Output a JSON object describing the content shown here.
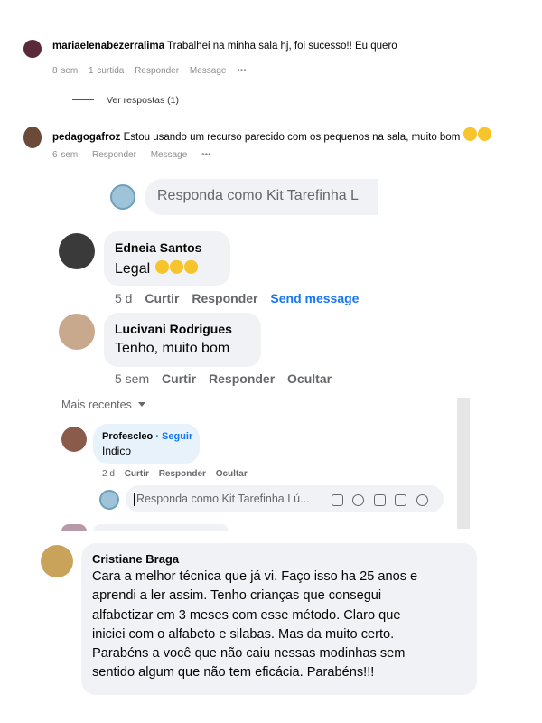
{
  "ig_comments": [
    {
      "username": "mariaelenabezerralima",
      "text": "Trabalhei na minha sala hj, foi sucesso!! Eu quero",
      "time": "8 sem",
      "likes": "1 curtida",
      "reply": "Responder",
      "message": "Message",
      "more": "•••",
      "view_replies": "Ver respostas (1)",
      "avatar_color": "#5a2a3a"
    },
    {
      "username": "pedagogafroz",
      "text": "Estou usando um recurso parecido com os pequenos na sala, muito bom",
      "time": "6 sem",
      "reply": "Responder",
      "message": "Message",
      "more": "•••",
      "avatar_color": "#6b4a3a"
    }
  ],
  "fb_reply_box_1": {
    "placeholder": "Responda como Kit Tarefinha L"
  },
  "fb_comments": [
    {
      "name": "Edneia Santos",
      "text": "Legal",
      "time": "5 d",
      "like": "Curtir",
      "reply": "Responder",
      "extra": "Send message",
      "avatar_color": "#3a3a3a"
    },
    {
      "name": "Lucivani Rodrigues",
      "text": "Tenho, muito bom",
      "time": "5 sem",
      "like": "Curtir",
      "reply": "Responder",
      "extra": "Ocultar",
      "avatar_color": "#c9a98e"
    }
  ],
  "sort_label": "Mais recentes",
  "small_comment": {
    "name": "Profescleo",
    "follow": "· Seguir",
    "text": "Indico",
    "time": "2 d",
    "like": "Curtir",
    "reply": "Responder",
    "hide": "Ocultar",
    "avatar_color": "#8a5a4a"
  },
  "fb_reply_box_2": {
    "placeholder": "Responda como Kit Tarefinha Lú..."
  },
  "big_comment": {
    "name": "Cristiane Braga",
    "lines": [
      "Cara a melhor técnica que já vi. Faço isso ha 25 anos e",
      "aprendi a ler assim. Tenho crianças que consegui",
      "alfabetizar em 3 meses com esse método. Claro que",
      "iniciei com o alfabeto e silabas. Mas da muito certo.",
      "Parabéns a você que não caiu nessas modinhas sem",
      "sentido algum que não tem eficácia. Parabéns!!!"
    ],
    "avatar_color": "#c9a35a"
  },
  "colors": {
    "bubble": "#f0f2f5",
    "link": "#1877f2",
    "meta": "#65676b"
  }
}
